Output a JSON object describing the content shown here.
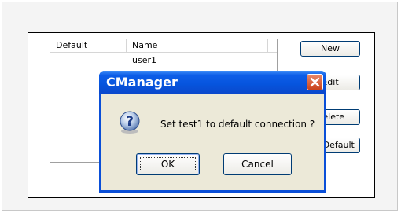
{
  "list": {
    "columns": [
      "Default",
      "Name"
    ],
    "rows": [
      {
        "default": "",
        "name": "user1"
      }
    ]
  },
  "side_buttons": {
    "new_label": "New",
    "edit_label": "Edit",
    "delete_label": "Delete",
    "set_default_label": "Set Default"
  },
  "dialog": {
    "title": "CManager",
    "message": "Set test1 to default connection ?",
    "ok_label": "OK",
    "cancel_label": "Cancel",
    "icon": "question-icon"
  }
}
